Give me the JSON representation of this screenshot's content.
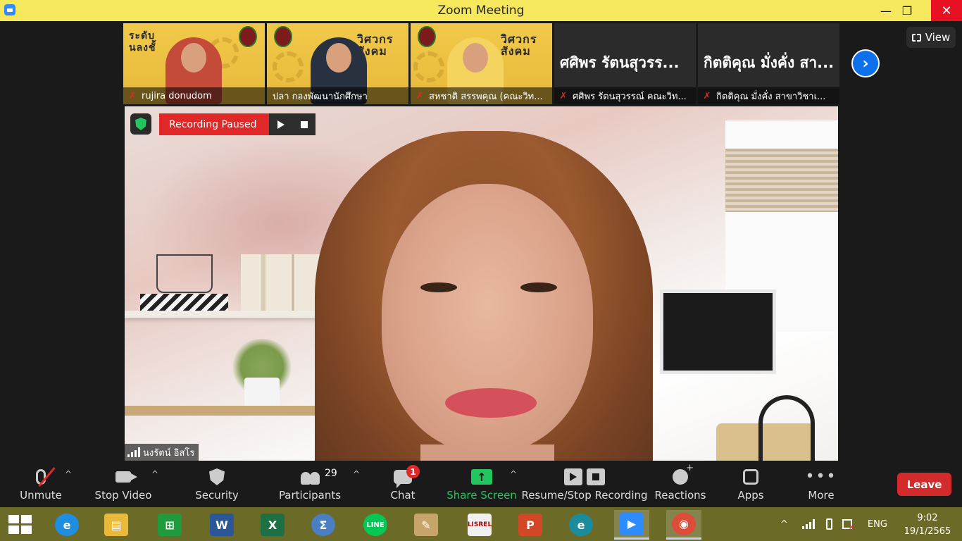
{
  "window": {
    "title": "Zoom Meeting",
    "minimize": "—",
    "maximize": "❐",
    "close": "✕"
  },
  "strip": {
    "tiles": [
      {
        "type": "video",
        "name": "rujira donudom",
        "poster": "ระดับ\nนลงชั้"
      },
      {
        "type": "video",
        "name": "ปลา กองพัฒนานักศึกษา",
        "poster": "วิศวกร\nสังคม"
      },
      {
        "type": "video",
        "name": "สหชาติ สรรพคุณ (คณะวิท...",
        "poster": "วิศวกร\nสังคม"
      },
      {
        "type": "text",
        "big": "ศศิพร รัตนสุวรร...",
        "name": "ศศิพร รัตนสุวรรณ์ คณะวิท..."
      },
      {
        "type": "text",
        "big": "กิตติคุณ มั่งคั่ง สา...",
        "name": "กิตติคุณ  มั่งคั่ง สาขาวิชาเ..."
      }
    ],
    "next": "›",
    "view_label": "View"
  },
  "main": {
    "recording_label": "Recording Paused",
    "speaker_name": "นงรัตน์ อิสโร"
  },
  "toolbar": {
    "unmute": "Unmute",
    "stop_video": "Stop Video",
    "security": "Security",
    "participants": "Participants",
    "participants_count": "29",
    "chat": "Chat",
    "chat_badge": "1",
    "share_screen": "Share Screen",
    "share_arrow": "↑",
    "record": "Resume/Stop Recording",
    "reactions": "Reactions",
    "apps": "Apps",
    "more": "More",
    "more_dots": "•••",
    "caret": "^",
    "leave": "Leave"
  },
  "taskbar": {
    "apps": [
      {
        "id": "ie",
        "glyph": "e",
        "color": "#1e8fe0"
      },
      {
        "id": "explorer",
        "glyph": "▤",
        "color": "#e8b93a"
      },
      {
        "id": "store",
        "glyph": "⊞",
        "color": "#1f9a3d"
      },
      {
        "id": "word",
        "glyph": "W",
        "color": "#2b5797"
      },
      {
        "id": "excel",
        "glyph": "X",
        "color": "#1d7044"
      },
      {
        "id": "math",
        "glyph": "Σ",
        "color": "#4a7fc1"
      },
      {
        "id": "line",
        "glyph": "LINE",
        "color": "#06c755"
      },
      {
        "id": "paint",
        "glyph": "✎",
        "color": "#c7a46a"
      },
      {
        "id": "lisrel",
        "glyph": "LISREL",
        "color": "#f0f0f0"
      },
      {
        "id": "powerpoint",
        "glyph": "P",
        "color": "#d24726"
      },
      {
        "id": "edge",
        "glyph": "e",
        "color": "#1b8c9e"
      },
      {
        "id": "zoom",
        "glyph": "▶",
        "color": "#2d8cff"
      },
      {
        "id": "chrome",
        "glyph": "◉",
        "color": "#dd4b39"
      }
    ],
    "tray_caret": "^",
    "lang": "ENG",
    "time": "9:02",
    "date": "19/1/2565"
  }
}
